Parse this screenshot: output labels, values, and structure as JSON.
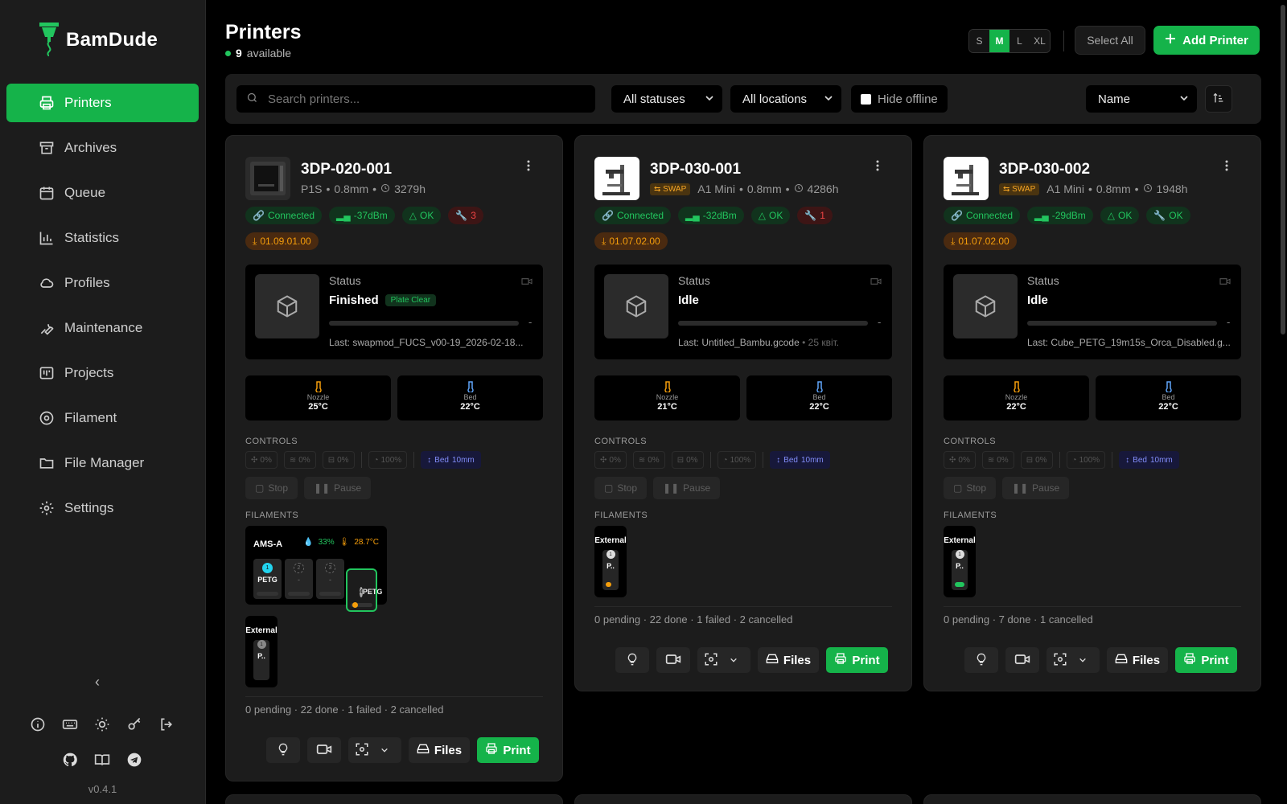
{
  "brand": {
    "name": "BamDude"
  },
  "sidebar": {
    "items": [
      {
        "label": "Printers",
        "icon": "printer-icon",
        "active": true
      },
      {
        "label": "Archives",
        "icon": "archive-icon"
      },
      {
        "label": "Queue",
        "icon": "calendar-icon"
      },
      {
        "label": "Statistics",
        "icon": "bar-chart-icon"
      },
      {
        "label": "Profiles",
        "icon": "cloud-icon"
      },
      {
        "label": "Maintenance",
        "icon": "wrench-icon"
      },
      {
        "label": "Projects",
        "icon": "kanban-icon"
      },
      {
        "label": "Filament",
        "icon": "spool-icon"
      },
      {
        "label": "File Manager",
        "icon": "folder-icon"
      },
      {
        "label": "Settings",
        "icon": "gear-icon"
      }
    ],
    "version": "v0.4.1"
  },
  "header": {
    "title": "Printers",
    "available_count": "9",
    "available_label": "available",
    "sizes": [
      "S",
      "M",
      "L",
      "XL"
    ],
    "size_selected": "M",
    "select_all": "Select All",
    "add_printer": "Add Printer"
  },
  "filters": {
    "search_placeholder": "Search printers...",
    "status": "All statuses",
    "location": "All locations",
    "hide_offline": "Hide offline",
    "sort": "Name"
  },
  "labels": {
    "status": "Status",
    "nozzle": "Nozzle",
    "bed": "Bed",
    "controls": "CONTROLS",
    "filaments": "FILAMENTS",
    "stop": "Stop",
    "pause": "Pause",
    "files": "Files",
    "print": "Print",
    "external": "External",
    "ctrl_fan1": "0%",
    "ctrl_fan2": "0%",
    "ctrl_fan3": "0%",
    "ctrl_speed": "100%",
    "ctrl_bed": "Bed",
    "ctrl_bed_val": "10mm"
  },
  "colors": {
    "accent": "#15b34a",
    "warning": "#f59e0b",
    "danger": "#ef4444"
  },
  "printers": [
    {
      "name": "3DP-020-001",
      "model": "P1S",
      "nozzle": "0.8mm",
      "hours": "3279h",
      "swap": "",
      "connection": "Connected",
      "signal": "-37dBm",
      "health": "OK",
      "maintenance": "3",
      "firmware": "01.09.01.00",
      "status": "Finished",
      "plate_badge": "Plate Clear",
      "progress_dash": "-",
      "last_file": "Last: swapmod_FUCS_v00-19_2026-02-18...",
      "last_date": "",
      "nozzle_temp": "25°C",
      "bed_temp": "22°C",
      "ams": {
        "name": "AMS-A",
        "humidity": "33%",
        "temp": "28.7°C",
        "slots": [
          {
            "num": "1",
            "type": "PETG"
          },
          {
            "num": "2",
            "type": "-"
          },
          {
            "num": "3",
            "type": "-"
          },
          {
            "num": "4",
            "type": "PETG"
          }
        ]
      },
      "external": {
        "num": "1",
        "type": "P.."
      },
      "queue": "0 pending · 22 done · 1 failed · 2 cancelled"
    },
    {
      "name": "3DP-030-001",
      "model": "A1 Mini",
      "nozzle": "0.8mm",
      "hours": "4286h",
      "swap": "SWAP",
      "connection": "Connected",
      "signal": "-32dBm",
      "health": "OK",
      "maintenance": "1",
      "firmware": "01.07.02.00",
      "status": "Idle",
      "plate_badge": "",
      "progress_dash": "-",
      "last_file": "Last: Untitled_Bambu.gcode",
      "last_date": "• 25 квіт.",
      "nozzle_temp": "21°C",
      "bed_temp": "22°C",
      "external": {
        "num": "1",
        "type": "P.."
      },
      "queue": "0 pending · 22 done · 1 failed · 2 cancelled"
    },
    {
      "name": "3DP-030-002",
      "model": "A1 Mini",
      "nozzle": "0.8mm",
      "hours": "1948h",
      "swap": "SWAP",
      "connection": "Connected",
      "signal": "-29dBm",
      "health": "OK",
      "maintenance": "OK",
      "firmware": "01.07.02.00",
      "status": "Idle",
      "plate_badge": "",
      "progress_dash": "-",
      "last_file": "Last: Cube_PETG_19m15s_Orca_Disabled.g...",
      "last_date": "",
      "nozzle_temp": "22°C",
      "bed_temp": "22°C",
      "external": {
        "num": "1",
        "type": "P.."
      },
      "queue": "0 pending · 7 done · 1 cancelled"
    }
  ]
}
